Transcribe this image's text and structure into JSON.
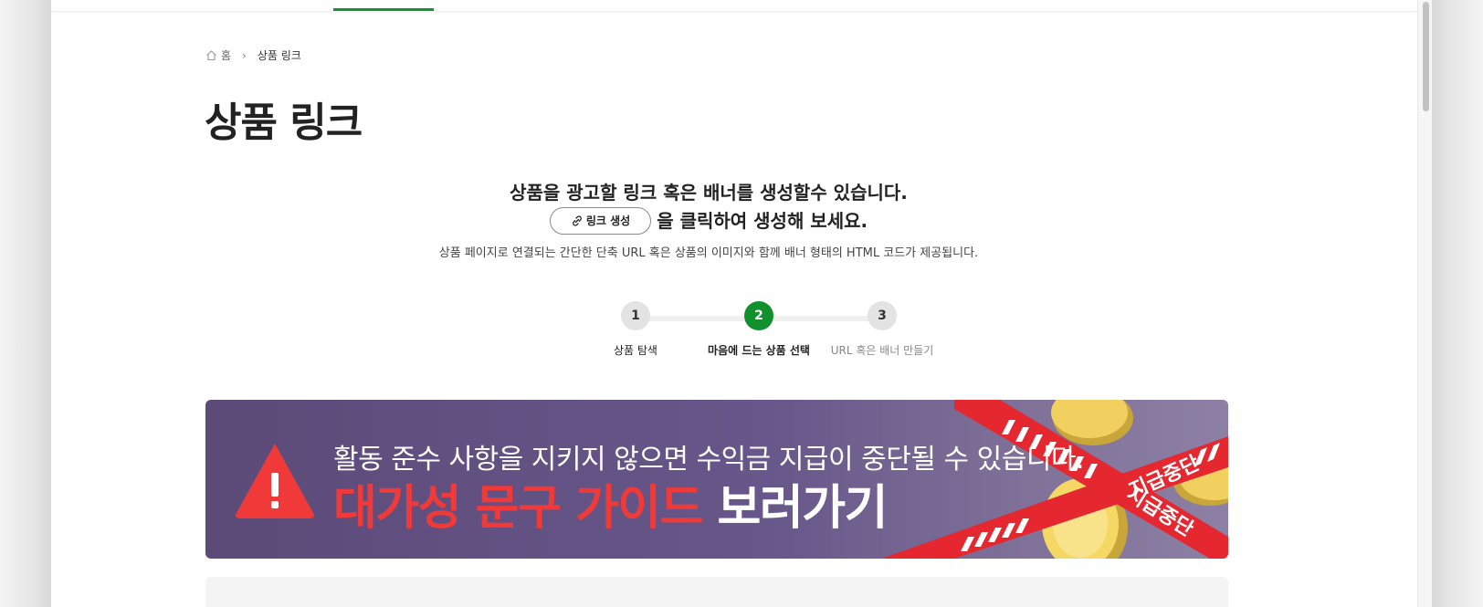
{
  "breadcrumb": {
    "home_label": "홈",
    "current_label": "상품 링크"
  },
  "page": {
    "title": "상품 링크"
  },
  "intro": {
    "line1": "상품을 광고할 링크 혹은 배너를 생성할수 있습니다.",
    "chip_label": "링크 생성",
    "line2_suffix": "을 클릭하여 생성해 보세요.",
    "subtext": "상품 페이지로 연결되는 간단한 단축 URL 혹은 상품의 이미지와 함께 배너 형태의 HTML 코드가 제공됩니다."
  },
  "stepper": {
    "current_step": 2,
    "steps": [
      {
        "number": "1",
        "label": "상품 탐색"
      },
      {
        "number": "2",
        "label": "마음에 드는 상품 선택"
      },
      {
        "number": "3",
        "label": "URL 혹은 배너 만들기"
      }
    ]
  },
  "banner": {
    "line1": "활동 준수 사항을 지키지 않으면 수익금 지급이 중단될 수 있습니다.",
    "highlight": "대가성 문구 가이드",
    "cta": "보러가기",
    "tape_text_1": "지급중단",
    "tape_text_2": "지급중단",
    "colors": {
      "red": "#f03a3a",
      "purple": "#5c4a78",
      "accent_green": "#11912d"
    }
  }
}
